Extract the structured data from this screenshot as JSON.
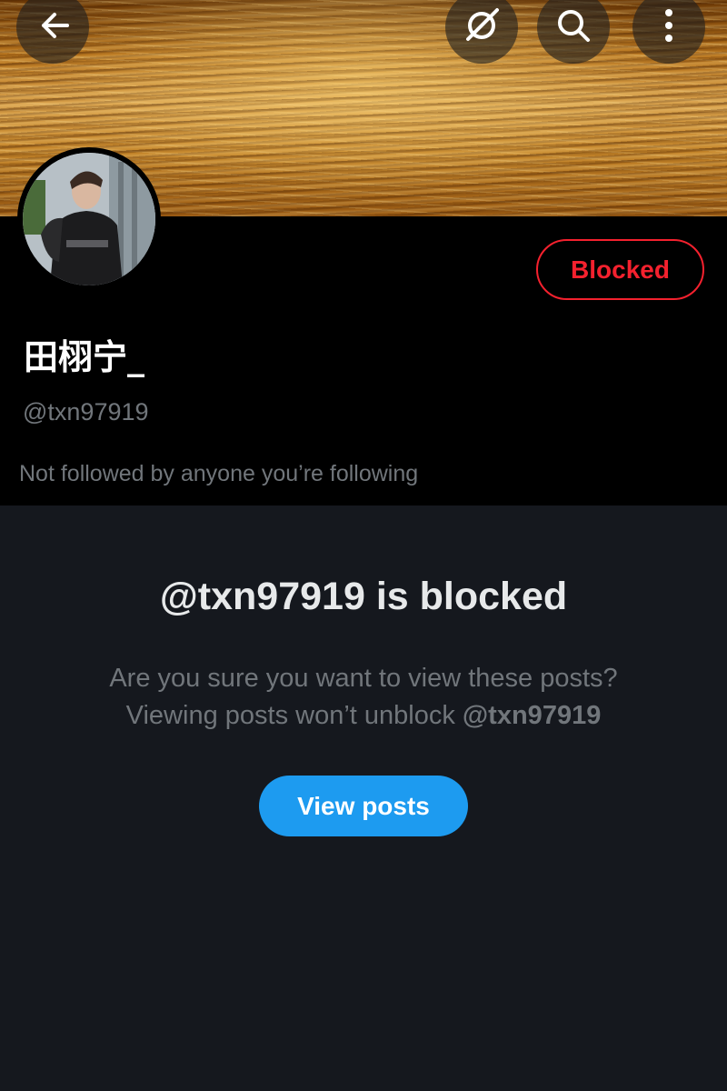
{
  "header": {
    "back_icon": "arrow-left-icon",
    "grok_icon": "grok-icon",
    "search_icon": "search-icon",
    "more_icon": "more-vertical-icon"
  },
  "profile": {
    "display_name": "田栩宁_",
    "handle": "@txn97919",
    "followed_note": "Not followed by anyone you’re following",
    "blocked_label": "Blocked",
    "blocked_color": "#f4212e"
  },
  "notice": {
    "title": "@txn97919 is blocked",
    "line1": "Are you sure you want to view these posts?",
    "line2_prefix": "Viewing posts won’t unblock ",
    "line2_handle": "@txn97919",
    "view_posts_label": "View posts",
    "accent_color": "#1d9bf0"
  }
}
